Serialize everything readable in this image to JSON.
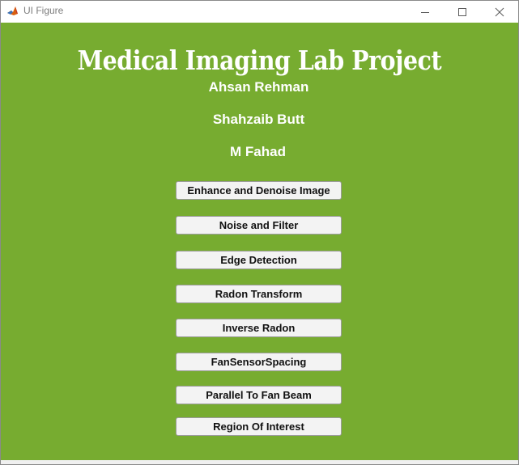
{
  "window": {
    "title": "UI Figure",
    "icon": "matlab-icon",
    "controls": {
      "minimize_icon": "minimize-icon",
      "maximize_icon": "maximize-icon",
      "close_icon": "close-icon"
    }
  },
  "colors": {
    "background": "#77ac30",
    "text": "#ffffff",
    "button_bg": "#f3f3f3"
  },
  "header": {
    "title": "Medical Imaging Lab Project",
    "authors": [
      "Ahsan Rehman",
      "Shahzaib Butt",
      "M Fahad"
    ]
  },
  "buttons": [
    {
      "label": "Enhance and Denoise Image"
    },
    {
      "label": "Noise and Filter"
    },
    {
      "label": "Edge Detection"
    },
    {
      "label": "Radon Transform"
    },
    {
      "label": "Inverse Radon"
    },
    {
      "label": "FanSensorSpacing"
    },
    {
      "label": "Parallel To Fan Beam"
    },
    {
      "label": "Region Of Interest"
    }
  ]
}
